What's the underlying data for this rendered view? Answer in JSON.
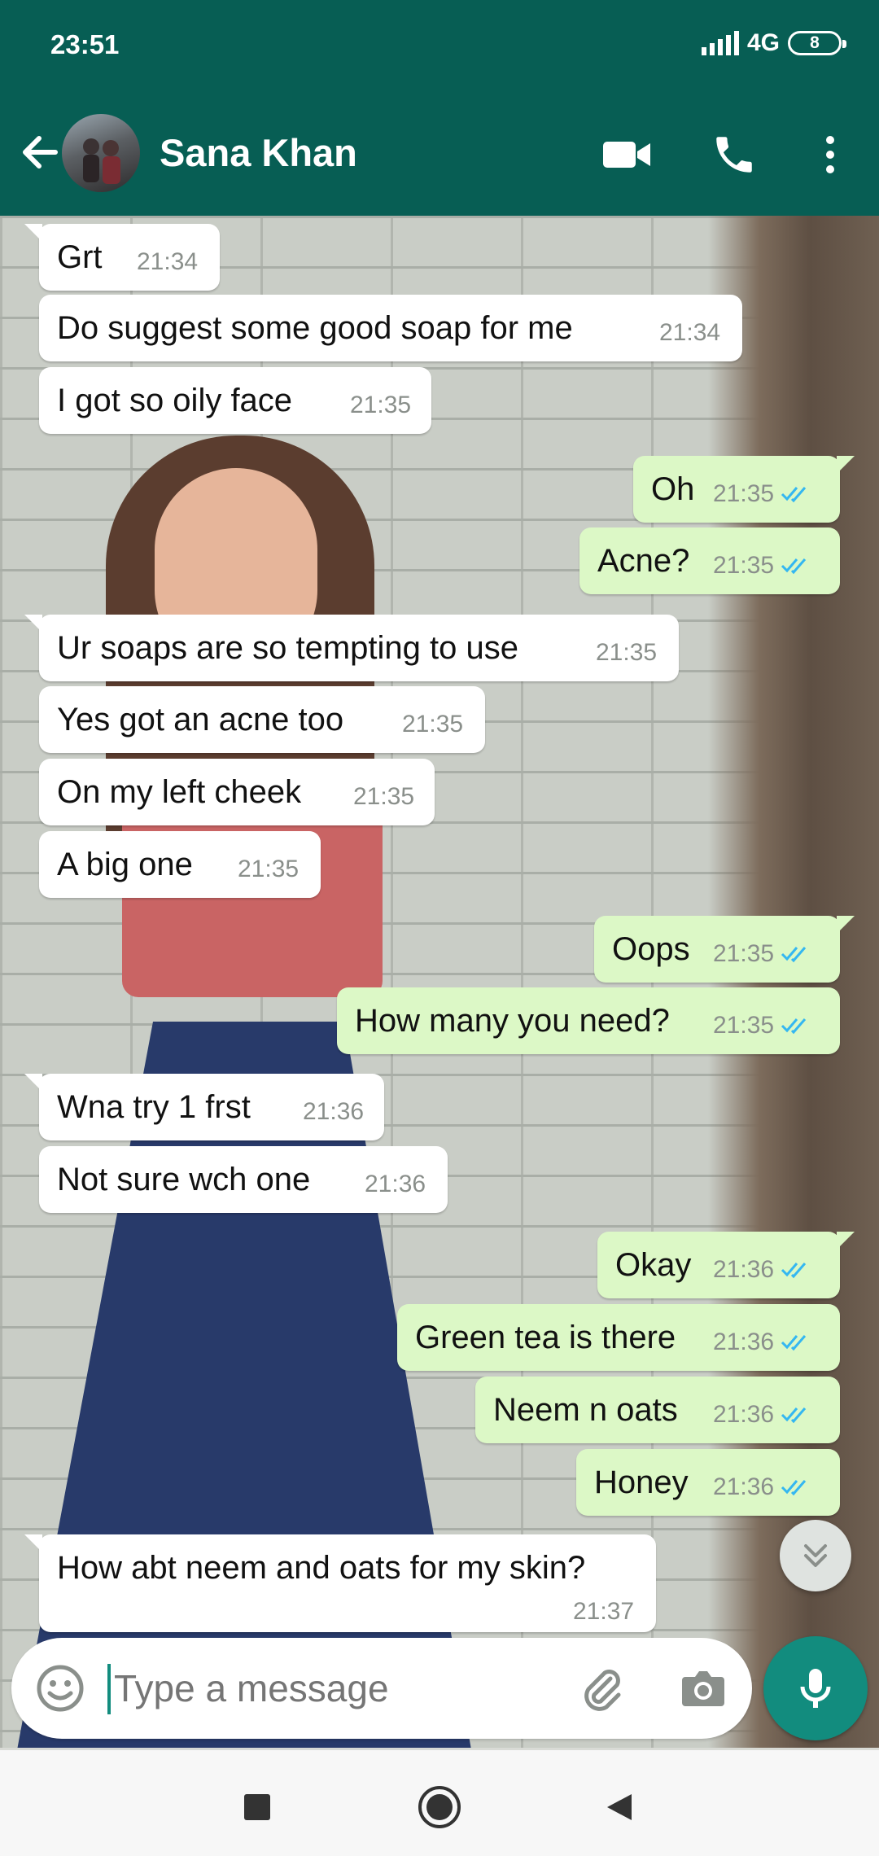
{
  "status_bar": {
    "time": "23:51",
    "network": "4G",
    "battery": "8"
  },
  "header": {
    "contact_name": "Sana Khan"
  },
  "messages": [
    {
      "dir": "in",
      "text": "Grt",
      "time": "21:34"
    },
    {
      "dir": "in",
      "text": "Do suggest some good soap for me",
      "time": "21:34"
    },
    {
      "dir": "in",
      "text": "I got so oily face",
      "time": "21:35"
    },
    {
      "dir": "out",
      "text": "Oh",
      "time": "21:35",
      "status": "read"
    },
    {
      "dir": "out",
      "text": "Acne?",
      "time": "21:35",
      "status": "read"
    },
    {
      "dir": "in",
      "text": "Ur soaps are so tempting to use",
      "time": "21:35"
    },
    {
      "dir": "in",
      "text": "Yes got an acne too",
      "time": "21:35"
    },
    {
      "dir": "in",
      "text": "On my left cheek",
      "time": "21:35"
    },
    {
      "dir": "in",
      "text": "A big one",
      "time": "21:35"
    },
    {
      "dir": "out",
      "text": "Oops",
      "time": "21:35",
      "status": "read"
    },
    {
      "dir": "out",
      "text": "How many you need?",
      "time": "21:35",
      "status": "read"
    },
    {
      "dir": "in",
      "text": "Wna try 1 frst",
      "time": "21:36"
    },
    {
      "dir": "in",
      "text": "Not sure wch one",
      "time": "21:36"
    },
    {
      "dir": "out",
      "text": "Okay",
      "time": "21:36",
      "status": "read"
    },
    {
      "dir": "out",
      "text": "Green tea is there",
      "time": "21:36",
      "status": "read"
    },
    {
      "dir": "out",
      "text": "Neem n oats",
      "time": "21:36",
      "status": "read"
    },
    {
      "dir": "out",
      "text": "Honey",
      "time": "21:36",
      "status": "read"
    },
    {
      "dir": "in",
      "text": "How abt neem and oats for my skin?",
      "time": "21:37"
    }
  ],
  "composer": {
    "placeholder": "Type a message"
  },
  "icons": {
    "back": "arrow-left-icon",
    "video": "video-call-icon",
    "call": "phone-icon",
    "menu": "more-vert-icon",
    "emoji": "emoji-icon",
    "attach": "paperclip-icon",
    "camera": "camera-icon",
    "mic": "mic-icon",
    "scroll": "double-chevron-down-icon"
  },
  "colors": {
    "header": "#075e54",
    "incoming": "#ffffff",
    "outgoing": "#dcf8c6",
    "accent": "#128c7e",
    "read_ticks": "#34b7f1"
  }
}
